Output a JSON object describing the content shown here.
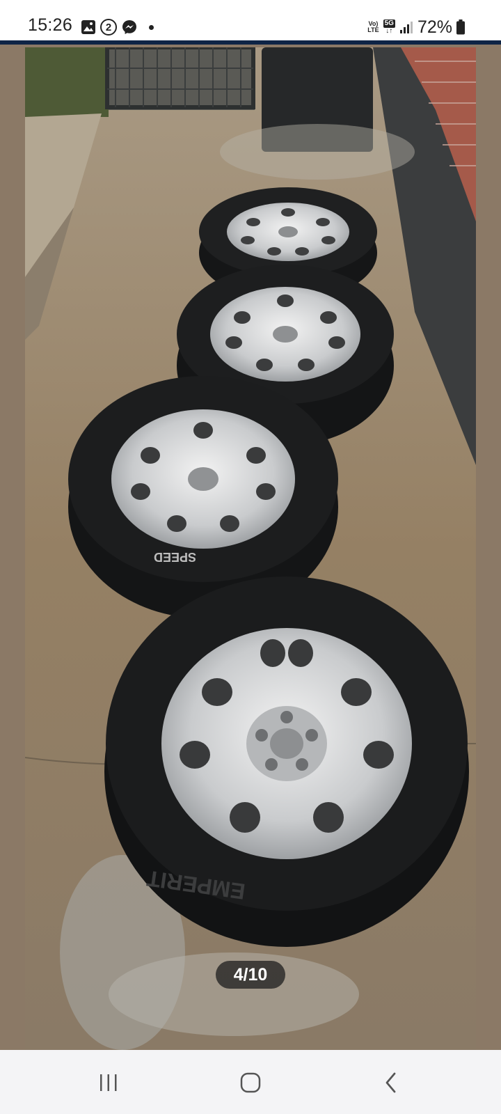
{
  "status_bar": {
    "time": "15:26",
    "left_icons": [
      "gallery-icon",
      "notification-count-icon",
      "messenger-icon",
      "dot-icon"
    ],
    "notification_count": "2",
    "network_label_top": "Vo)",
    "network_label_bottom": "LTE",
    "network_type": "5G",
    "battery": "72%"
  },
  "viewer": {
    "page_indicator": "4/10",
    "image_description_icon": "wheel-photo"
  },
  "nav_bar": {
    "items": [
      "recent-apps-icon",
      "home-icon",
      "back-icon"
    ]
  },
  "colors": {
    "accent_line": "#0e2446",
    "viewer_background": "#8b7966",
    "nav_background": "#f4f4f6"
  }
}
